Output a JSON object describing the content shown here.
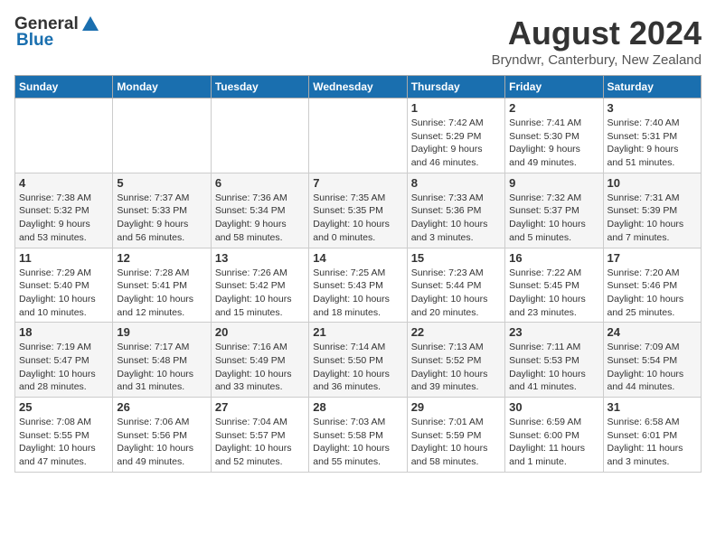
{
  "header": {
    "logo_general": "General",
    "logo_blue": "Blue",
    "month_title": "August 2024",
    "location": "Bryndwr, Canterbury, New Zealand"
  },
  "calendar": {
    "days_of_week": [
      "Sunday",
      "Monday",
      "Tuesday",
      "Wednesday",
      "Thursday",
      "Friday",
      "Saturday"
    ],
    "weeks": [
      [
        {
          "day": "",
          "info": ""
        },
        {
          "day": "",
          "info": ""
        },
        {
          "day": "",
          "info": ""
        },
        {
          "day": "",
          "info": ""
        },
        {
          "day": "1",
          "info": "Sunrise: 7:42 AM\nSunset: 5:29 PM\nDaylight: 9 hours\nand 46 minutes."
        },
        {
          "day": "2",
          "info": "Sunrise: 7:41 AM\nSunset: 5:30 PM\nDaylight: 9 hours\nand 49 minutes."
        },
        {
          "day": "3",
          "info": "Sunrise: 7:40 AM\nSunset: 5:31 PM\nDaylight: 9 hours\nand 51 minutes."
        }
      ],
      [
        {
          "day": "4",
          "info": "Sunrise: 7:38 AM\nSunset: 5:32 PM\nDaylight: 9 hours\nand 53 minutes."
        },
        {
          "day": "5",
          "info": "Sunrise: 7:37 AM\nSunset: 5:33 PM\nDaylight: 9 hours\nand 56 minutes."
        },
        {
          "day": "6",
          "info": "Sunrise: 7:36 AM\nSunset: 5:34 PM\nDaylight: 9 hours\nand 58 minutes."
        },
        {
          "day": "7",
          "info": "Sunrise: 7:35 AM\nSunset: 5:35 PM\nDaylight: 10 hours\nand 0 minutes."
        },
        {
          "day": "8",
          "info": "Sunrise: 7:33 AM\nSunset: 5:36 PM\nDaylight: 10 hours\nand 3 minutes."
        },
        {
          "day": "9",
          "info": "Sunrise: 7:32 AM\nSunset: 5:37 PM\nDaylight: 10 hours\nand 5 minutes."
        },
        {
          "day": "10",
          "info": "Sunrise: 7:31 AM\nSunset: 5:39 PM\nDaylight: 10 hours\nand 7 minutes."
        }
      ],
      [
        {
          "day": "11",
          "info": "Sunrise: 7:29 AM\nSunset: 5:40 PM\nDaylight: 10 hours\nand 10 minutes."
        },
        {
          "day": "12",
          "info": "Sunrise: 7:28 AM\nSunset: 5:41 PM\nDaylight: 10 hours\nand 12 minutes."
        },
        {
          "day": "13",
          "info": "Sunrise: 7:26 AM\nSunset: 5:42 PM\nDaylight: 10 hours\nand 15 minutes."
        },
        {
          "day": "14",
          "info": "Sunrise: 7:25 AM\nSunset: 5:43 PM\nDaylight: 10 hours\nand 18 minutes."
        },
        {
          "day": "15",
          "info": "Sunrise: 7:23 AM\nSunset: 5:44 PM\nDaylight: 10 hours\nand 20 minutes."
        },
        {
          "day": "16",
          "info": "Sunrise: 7:22 AM\nSunset: 5:45 PM\nDaylight: 10 hours\nand 23 minutes."
        },
        {
          "day": "17",
          "info": "Sunrise: 7:20 AM\nSunset: 5:46 PM\nDaylight: 10 hours\nand 25 minutes."
        }
      ],
      [
        {
          "day": "18",
          "info": "Sunrise: 7:19 AM\nSunset: 5:47 PM\nDaylight: 10 hours\nand 28 minutes."
        },
        {
          "day": "19",
          "info": "Sunrise: 7:17 AM\nSunset: 5:48 PM\nDaylight: 10 hours\nand 31 minutes."
        },
        {
          "day": "20",
          "info": "Sunrise: 7:16 AM\nSunset: 5:49 PM\nDaylight: 10 hours\nand 33 minutes."
        },
        {
          "day": "21",
          "info": "Sunrise: 7:14 AM\nSunset: 5:50 PM\nDaylight: 10 hours\nand 36 minutes."
        },
        {
          "day": "22",
          "info": "Sunrise: 7:13 AM\nSunset: 5:52 PM\nDaylight: 10 hours\nand 39 minutes."
        },
        {
          "day": "23",
          "info": "Sunrise: 7:11 AM\nSunset: 5:53 PM\nDaylight: 10 hours\nand 41 minutes."
        },
        {
          "day": "24",
          "info": "Sunrise: 7:09 AM\nSunset: 5:54 PM\nDaylight: 10 hours\nand 44 minutes."
        }
      ],
      [
        {
          "day": "25",
          "info": "Sunrise: 7:08 AM\nSunset: 5:55 PM\nDaylight: 10 hours\nand 47 minutes."
        },
        {
          "day": "26",
          "info": "Sunrise: 7:06 AM\nSunset: 5:56 PM\nDaylight: 10 hours\nand 49 minutes."
        },
        {
          "day": "27",
          "info": "Sunrise: 7:04 AM\nSunset: 5:57 PM\nDaylight: 10 hours\nand 52 minutes."
        },
        {
          "day": "28",
          "info": "Sunrise: 7:03 AM\nSunset: 5:58 PM\nDaylight: 10 hours\nand 55 minutes."
        },
        {
          "day": "29",
          "info": "Sunrise: 7:01 AM\nSunset: 5:59 PM\nDaylight: 10 hours\nand 58 minutes."
        },
        {
          "day": "30",
          "info": "Sunrise: 6:59 AM\nSunset: 6:00 PM\nDaylight: 11 hours\nand 1 minute."
        },
        {
          "day": "31",
          "info": "Sunrise: 6:58 AM\nSunset: 6:01 PM\nDaylight: 11 hours\nand 3 minutes."
        }
      ]
    ]
  }
}
